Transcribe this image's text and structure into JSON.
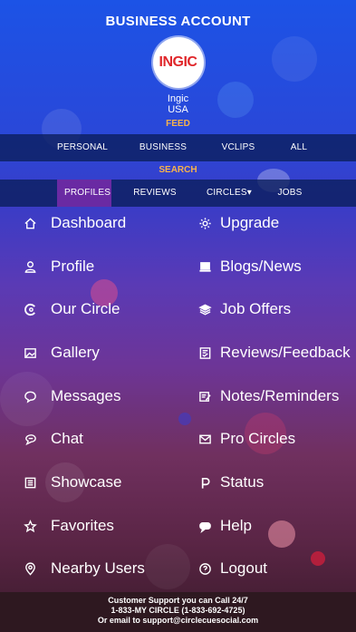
{
  "header": {
    "title": "BUSINESS ACCOUNT",
    "logo_text": "INGIC",
    "user_name": "Ingic",
    "user_country": "USA",
    "feed_label": "FEED"
  },
  "feed_tabs": [
    "PERSONAL",
    "BUSINESS",
    "VCLIPS",
    "ALL"
  ],
  "search_label": "SEARCH",
  "search_tabs": [
    {
      "label": "PROFILES",
      "active": true
    },
    {
      "label": "REVIEWS",
      "active": false
    },
    {
      "label": "CIRCLES▾",
      "active": false
    },
    {
      "label": "JOBS",
      "active": false
    }
  ],
  "menu": {
    "left": [
      {
        "label": "Dashboard",
        "icon": "home-icon"
      },
      {
        "label": "Profile",
        "icon": "user-icon"
      },
      {
        "label": "Our Circle",
        "icon": "circle-icon"
      },
      {
        "label": "Gallery",
        "icon": "gallery-icon"
      },
      {
        "label": "Messages",
        "icon": "message-icon"
      },
      {
        "label": "Chat",
        "icon": "chat-icon"
      },
      {
        "label": "Showcase",
        "icon": "showcase-icon"
      },
      {
        "label": "Favorites",
        "icon": "star-icon"
      },
      {
        "label": "Nearby Users",
        "icon": "location-icon"
      }
    ],
    "right": [
      {
        "label": "Upgrade",
        "icon": "gear-icon"
      },
      {
        "label": "Blogs/News",
        "icon": "laptop-icon"
      },
      {
        "label": "Job Offers",
        "icon": "layers-icon"
      },
      {
        "label": "Reviews/Feedback",
        "icon": "review-icon"
      },
      {
        "label": "Notes/Reminders",
        "icon": "note-icon"
      },
      {
        "label": "Pro Circles",
        "icon": "mail-icon"
      },
      {
        "label": "Status",
        "icon": "status-icon"
      },
      {
        "label": "Help",
        "icon": "help-chat-icon"
      },
      {
        "label": "Logout",
        "icon": "logout-icon"
      }
    ]
  },
  "footer": {
    "line1": "Customer Support you can Call 24/7",
    "line2": "1-833-MY CIRCLE (1-833-692-4725)",
    "line3": "Or email to support@circlecuesocial.com"
  },
  "colors": {
    "accent": "#f6b24c",
    "active_tab": "#6a2aa3",
    "logo_red": "#e0272b"
  }
}
